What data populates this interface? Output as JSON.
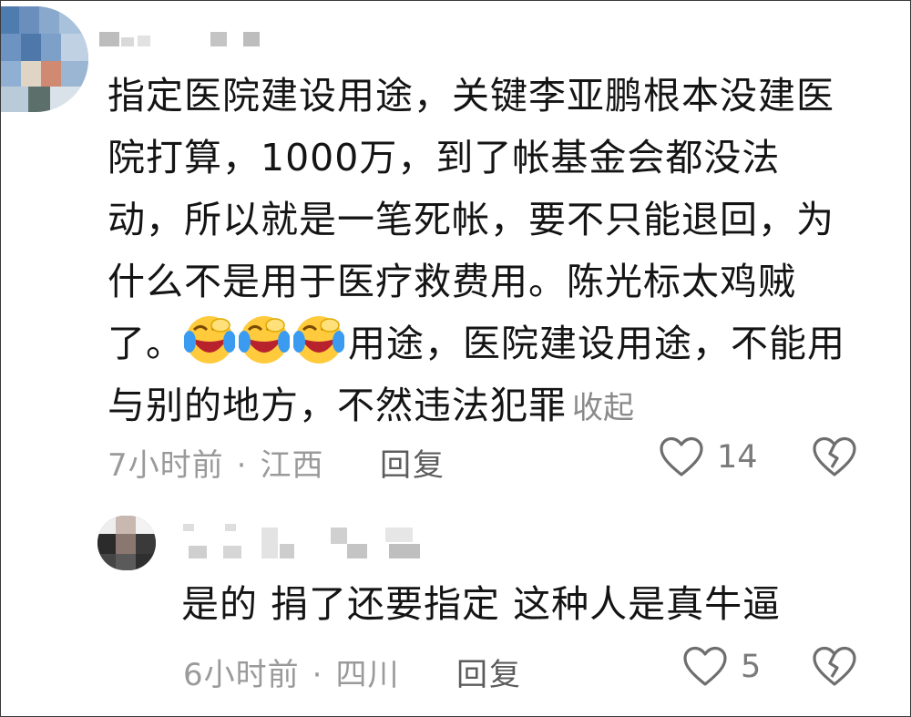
{
  "comments": [
    {
      "text_before_emoji": "指定医院建设用途，关键李亚鹏根本没建医院打算，1000万，到了帐基金会都没法动，所以就是一笔死帐，要不只能退回，为什么不是用于医疗救费用。陈光标太鸡贼了。",
      "emoji": [
        "laughing-crying-emoji",
        "laughing-crying-emoji",
        "laughing-crying-emoji"
      ],
      "text_after_emoji": "用途，医院建设用途，不能用与别的地方，不然违法犯罪",
      "collapse_label": "收起",
      "time": "7小时前",
      "location": "江西",
      "reply_label": "回复",
      "likes": "14"
    },
    {
      "text": "是的 捐了还要指定 这种人是真牛逼",
      "time": "6小时前",
      "location": "四川",
      "reply_label": "回复",
      "likes": "5"
    }
  ],
  "meta_separator": "·",
  "icons": {
    "like": "heart-outline-icon",
    "dislike": "broken-heart-icon"
  },
  "colors": {
    "text": "#141414",
    "meta": "#9a9a9a",
    "reply": "#5c5c5c",
    "icon": "#6e6e6e"
  }
}
